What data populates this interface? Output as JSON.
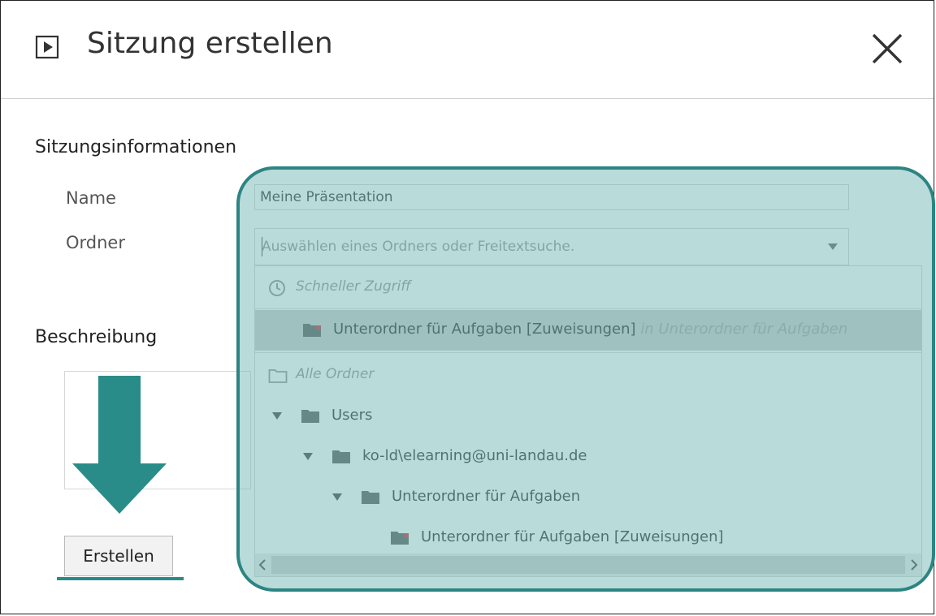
{
  "dialog": {
    "title": "Sitzung erstellen",
    "icons": {
      "title": "play-icon",
      "close": "close-icon"
    }
  },
  "sections": {
    "info_title": "Sitzungsinformationen",
    "description_title": "Beschreibung"
  },
  "fields": {
    "name_label": "Name",
    "name_value": "Meine Präsentation",
    "folder_label": "Ordner",
    "folder_placeholder": "Auswählen eines Ordners oder Freitextsuche."
  },
  "dropdown": {
    "quick_access_label": "Schneller Zugriff",
    "quick_access_items": [
      {
        "text": "Unterordner für Aufgaben [Zuweisungen]",
        "path": "in Unterordner für Aufgaben",
        "selected": true
      }
    ],
    "all_folders_label": "Alle Ordner",
    "tree": [
      {
        "label": "Users",
        "expanded": true,
        "level": 0
      },
      {
        "label": "ko-ld\\elearning@uni-landau.de",
        "expanded": true,
        "level": 1
      },
      {
        "label": "Unterordner für Aufgaben",
        "expanded": true,
        "level": 2
      },
      {
        "label": "Unterordner für Aufgaben [Zuweisungen]",
        "level": 3,
        "assignment": true
      }
    ]
  },
  "buttons": {
    "create": "Erstellen"
  },
  "colors": {
    "highlight_fill": "#7ebcba",
    "highlight_border": "#2c8582",
    "arrow": "#2a8c88",
    "folder_icon": "#4a4a4a",
    "assignment_dot": "#d0182a"
  }
}
